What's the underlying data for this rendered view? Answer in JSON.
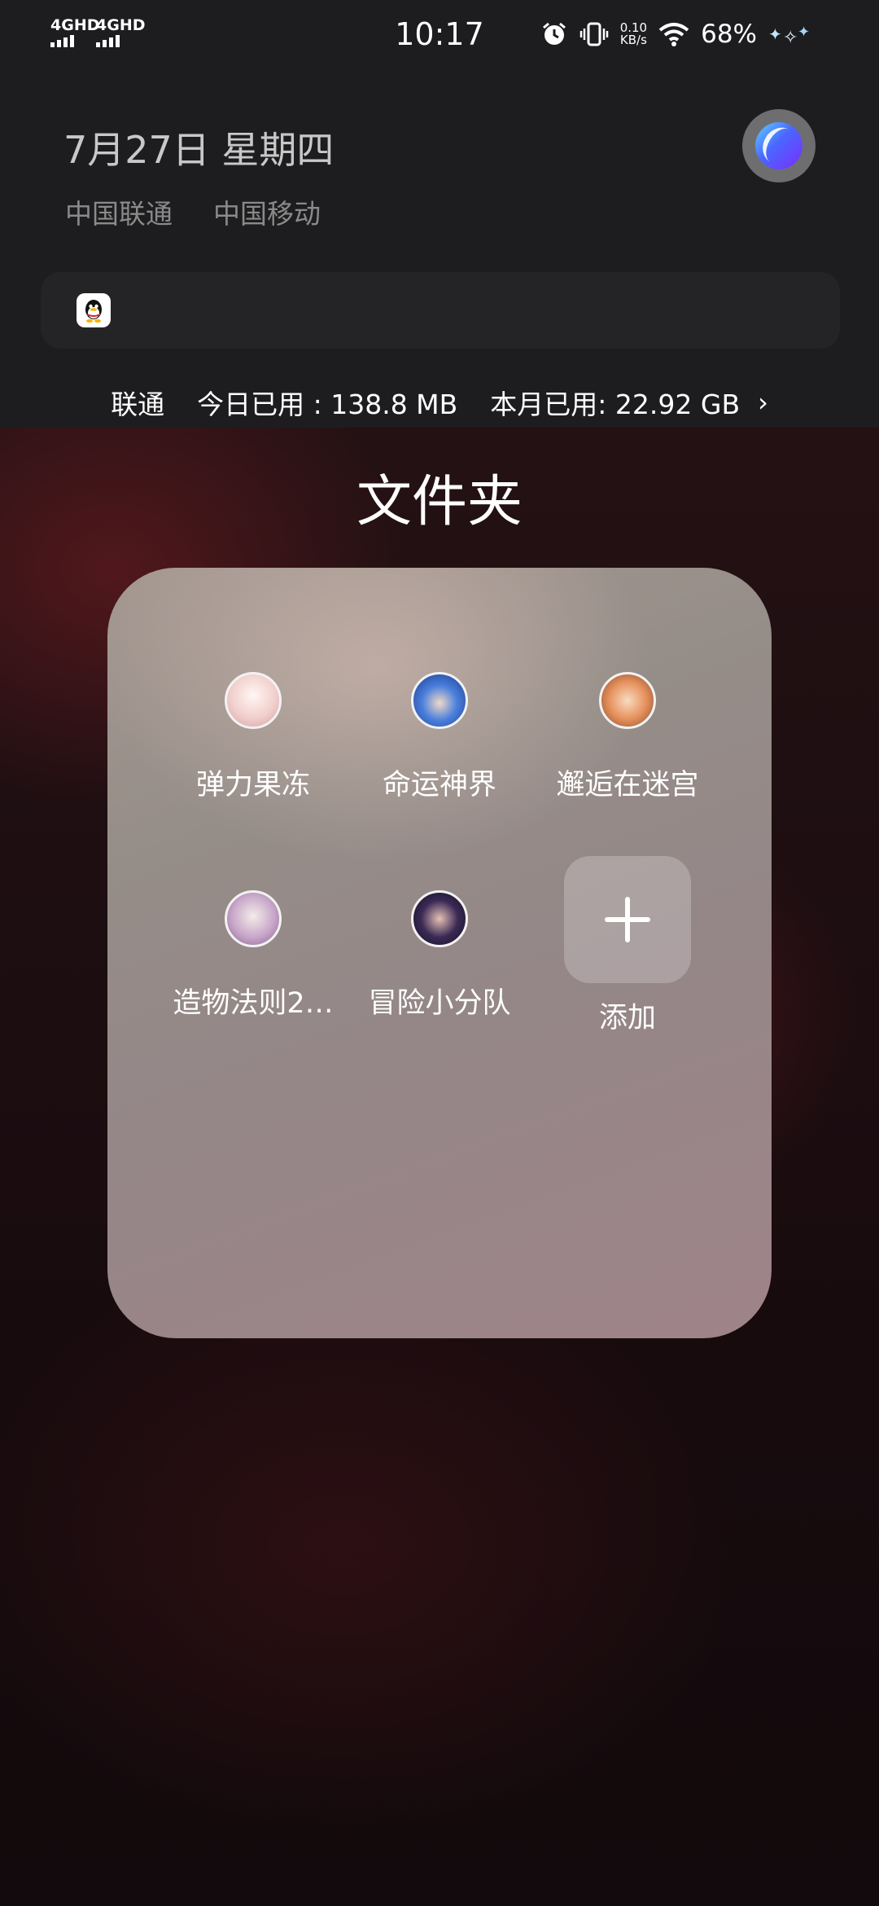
{
  "status_bar": {
    "time": "10:17",
    "sim1_label": "4GHD",
    "sim2_label": "4GHD",
    "net_speed_value": "0.10",
    "net_speed_unit": "KB/s",
    "battery": "68%",
    "icons": [
      "alarm-icon",
      "vibrate-icon",
      "wifi-icon",
      "notification-sparkle-icon"
    ]
  },
  "shade": {
    "date": "7月27日 星期四",
    "carriers": [
      "中国联通",
      "中国移动"
    ],
    "notification_app_icon": "qq-icon",
    "data_usage": {
      "carrier": "联通",
      "today": "今日已用 : 138.8 MB",
      "month": "本月已用: 22.92 GB",
      "chevron": "›"
    }
  },
  "folder": {
    "title": "文件夹",
    "apps": [
      {
        "label": "弹力果冻",
        "icon": "anime-girl-white-hair-icon",
        "color": "#f4d6d2"
      },
      {
        "label": "命运神界",
        "icon": "anime-girl-blue-hair-icon",
        "color": "#3b6fd0"
      },
      {
        "label": "邂逅在迷宫",
        "icon": "anime-girl-orange-hair-icon",
        "color": "#e7925e"
      },
      {
        "label": "造物法则2…",
        "icon": "anime-girl-silver-hair-icon",
        "color": "#c7a6c9"
      },
      {
        "label": "冒险小分队",
        "icon": "anime-girl-dark-hair-icon",
        "color": "#3a2a55"
      }
    ],
    "add_label": "添加"
  }
}
